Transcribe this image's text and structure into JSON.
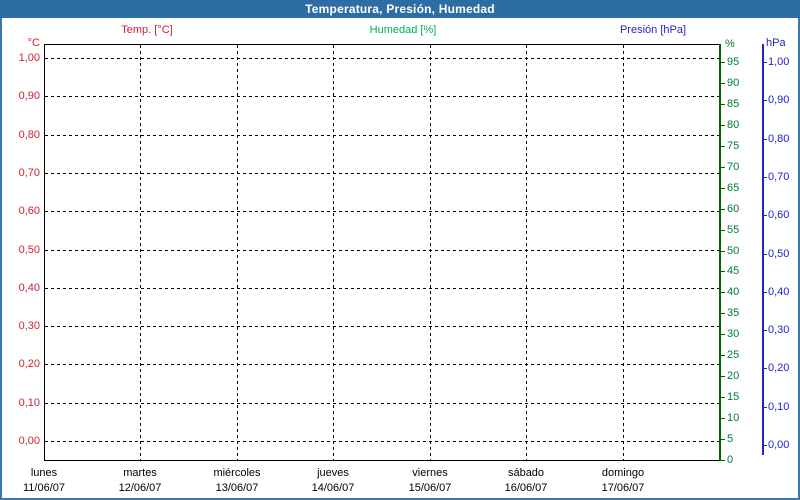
{
  "header": {
    "title": "Temperatura, Presión, Humedad"
  },
  "legend": {
    "temp_label": "Temp. [°C]",
    "humidity_label": "Humedad [%]",
    "pressure_label": "Presión [hPa]"
  },
  "axes": {
    "temp": {
      "unit": "°C",
      "ticks": [
        "1,00",
        "0,90",
        "0,80",
        "0,70",
        "0,60",
        "0,50",
        "0,40",
        "0,30",
        "0,20",
        "0,10",
        "0,00"
      ]
    },
    "humidity": {
      "unit": "%",
      "ticks": [
        "95",
        "90",
        "85",
        "80",
        "75",
        "70",
        "65",
        "60",
        "55",
        "50",
        "45",
        "40",
        "35",
        "30",
        "25",
        "20",
        "15",
        "10",
        "5",
        "0"
      ]
    },
    "pressure": {
      "unit": "hPa",
      "ticks": [
        "1,00",
        "0,90",
        "0,80",
        "0,70",
        "0,60",
        "0,50",
        "0,40",
        "0,30",
        "0,20",
        "0,10",
        "0,00"
      ]
    }
  },
  "x_axis": {
    "days": [
      {
        "name": "lunes",
        "date": "11/06/07"
      },
      {
        "name": "martes",
        "date": "12/06/07"
      },
      {
        "name": "miércoles",
        "date": "13/06/07"
      },
      {
        "name": "jueves",
        "date": "14/06/07"
      },
      {
        "name": "viernes",
        "date": "15/06/07"
      },
      {
        "name": "sábado",
        "date": "16/06/07"
      },
      {
        "name": "domingo",
        "date": "17/06/07"
      }
    ]
  },
  "colors": {
    "temp": "#cc2233",
    "humidity_axis": "#007a33",
    "humidity_legend": "#00b050",
    "pressure": "#2222cc",
    "header_bg": "#2e6da4",
    "window_border": "#3a77ad",
    "grid": "#000000",
    "green_axis_line": "#006400",
    "frame": "#000000"
  },
  "chart_data": {
    "type": "line",
    "title": "Temperatura, Presión, Humedad",
    "x_categories": [
      "lunes 11/06/07",
      "martes 12/06/07",
      "miércoles 13/06/07",
      "jueves 14/06/07",
      "viernes 15/06/07",
      "sábado 16/06/07",
      "domingo 17/06/07"
    ],
    "y_axes": [
      {
        "name": "Temperatura",
        "unit": "°C",
        "side": "left",
        "min": 0.0,
        "max": 1.0,
        "step": 0.1,
        "tick_format": "comma-decimal",
        "color": "#cc2233"
      },
      {
        "name": "Humedad",
        "unit": "%",
        "side": "right-inner",
        "min": 0,
        "max": 95,
        "step": 5,
        "color": "#007a33"
      },
      {
        "name": "Presión",
        "unit": "hPa",
        "side": "right-outer",
        "min": 0.0,
        "max": 1.0,
        "step": 0.1,
        "tick_format": "comma-decimal",
        "color": "#2222cc"
      }
    ],
    "series": [
      {
        "name": "Temp. [°C]",
        "axis": "Temperatura",
        "values": []
      },
      {
        "name": "Humedad [%]",
        "axis": "Humedad",
        "values": []
      },
      {
        "name": "Presión [hPa]",
        "axis": "Presión",
        "values": []
      }
    ],
    "grid": true,
    "grid_style": "dashed",
    "legend_position": "top",
    "plot_is_empty": true
  }
}
